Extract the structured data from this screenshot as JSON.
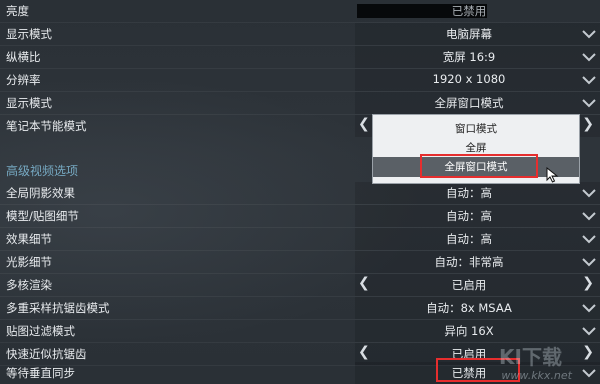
{
  "rows": [
    {
      "label": "亮度",
      "value": "已禁用"
    },
    {
      "label": "显示模式",
      "value": "电脑屏幕"
    },
    {
      "label": "纵横比",
      "value": "宽屏 16:9"
    },
    {
      "label": "分辨率",
      "value": "1920 x 1080"
    },
    {
      "label": "显示模式",
      "value": "全屏窗口模式"
    },
    {
      "label": "笔记本节能模式",
      "value": ""
    }
  ],
  "section_title": "高级视频选项",
  "adv_rows": [
    {
      "label": "全局阴影效果",
      "value": "自动：高"
    },
    {
      "label": "模型/贴图细节",
      "value": "自动：高"
    },
    {
      "label": "效果细节",
      "value": "自动：高"
    },
    {
      "label": "光影细节",
      "value": "自动：非常高"
    },
    {
      "label": "多核渲染",
      "value": "已启用"
    },
    {
      "label": "多重采样抗锯齿模式",
      "value": "自动：8x MSAA"
    },
    {
      "label": "贴图过滤模式",
      "value": "异向 16X"
    },
    {
      "label": "快速近似抗锯齿",
      "value": "已启用"
    },
    {
      "label": "等待垂直同步",
      "value": "已禁用"
    }
  ],
  "dropdown": {
    "options": [
      "窗口模式",
      "全屏",
      "全屏窗口模式"
    ],
    "selected_index": 2
  },
  "arrows": {
    "left": "❮",
    "right": "❯"
  },
  "icons": {
    "chevron": "chevron-down-icon",
    "cursor": "mouse-cursor-icon"
  },
  "watermark": {
    "logo": "KI下载",
    "text": "www.kkx.net"
  },
  "colors": {
    "section": "#76a9c2",
    "highlight_box": "#e62e2e",
    "selected_option_bg": "#5a6066"
  }
}
